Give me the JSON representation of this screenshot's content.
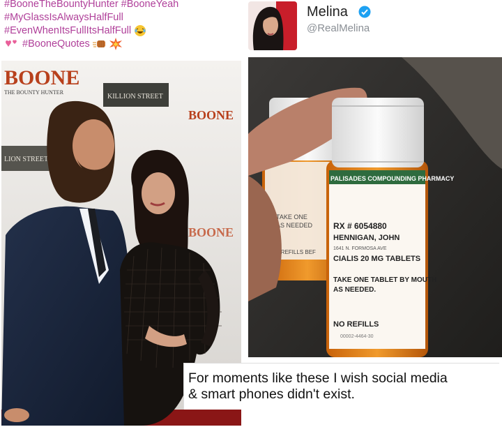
{
  "hashtags": {
    "line1": "#BooneTheBountyHunter #BooneYeah",
    "line2": "#MyGlassIsAlwaysHalfFull",
    "line3": "#EvenWhenItsFullItsHalfFull",
    "line4": "#BooneQuotes"
  },
  "tweet": {
    "display_name": "Melina",
    "handle": "@RealMelina",
    "verified_icon": "verified-badge-icon"
  },
  "backdrop": {
    "boone_logo": "BOONE",
    "boone_tagline": "THE BOUNTY HUNTER",
    "sponsor_1": "KILLION STREET",
    "sponsor_2": "LION STREET"
  },
  "prescription": {
    "pharmacy": "PALISADES COMPOUNDING PHARMACY",
    "rx_number": "RX # 6054880",
    "patient": "HENNIGAN, JOHN",
    "address": "1641 N. FORMOSA AVE",
    "drug": "CIALIS 20 MG TABLETS",
    "instructions_1": "TAKE ONE TABLET BY MOUTH",
    "instructions_2": "AS NEEDED.",
    "refills": "NO REFILLS",
    "ndc": "00002-4464-30",
    "back_take_one": "TAKE ONE",
    "back_as_needed": "AS NEEDED",
    "back_refills": "1 REFILLS BEF"
  },
  "caption": {
    "line1": "For moments like these I wish social media",
    "line2": "& smart phones didn't exist."
  },
  "colors": {
    "hashtag": "#b0409a",
    "verified": "#1da1f2",
    "pill_bottle": "#e07a10",
    "cap": "#f4f4f4"
  }
}
